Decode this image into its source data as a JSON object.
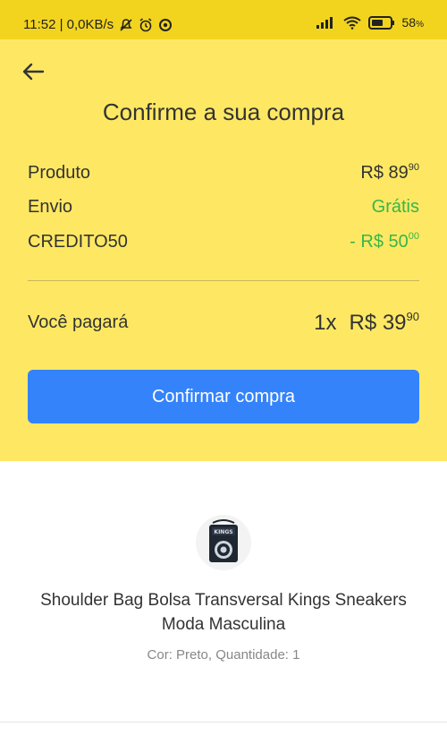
{
  "status_bar": {
    "time": "11:52 | 0,0KB/s",
    "battery": "58"
  },
  "header": {
    "title": "Confirme a sua compra"
  },
  "summary": {
    "product": {
      "label": "Produto",
      "currency": "R$ 89",
      "cents": "90"
    },
    "shipping": {
      "label": "Envio",
      "value": "Grátis"
    },
    "coupon": {
      "label": "CREDITO50",
      "currency": "- R$ 50",
      "cents": "00"
    }
  },
  "total": {
    "label": "Você pagará",
    "quantity": "1x",
    "currency": "R$ 39",
    "cents": "90"
  },
  "confirm_button": {
    "label": "Confirmar compra"
  },
  "product": {
    "name": "Shoulder Bag Bolsa Transversal Kings Sneakers Moda Masculina",
    "meta": "Cor: Preto, Quantidade: 1",
    "image_icon": "bag-product-image"
  },
  "colors": {
    "yellow_bg": "#fee863",
    "status_bar": "#f2d41e",
    "accent_blue": "#3483fa",
    "green": "#39b54a"
  }
}
